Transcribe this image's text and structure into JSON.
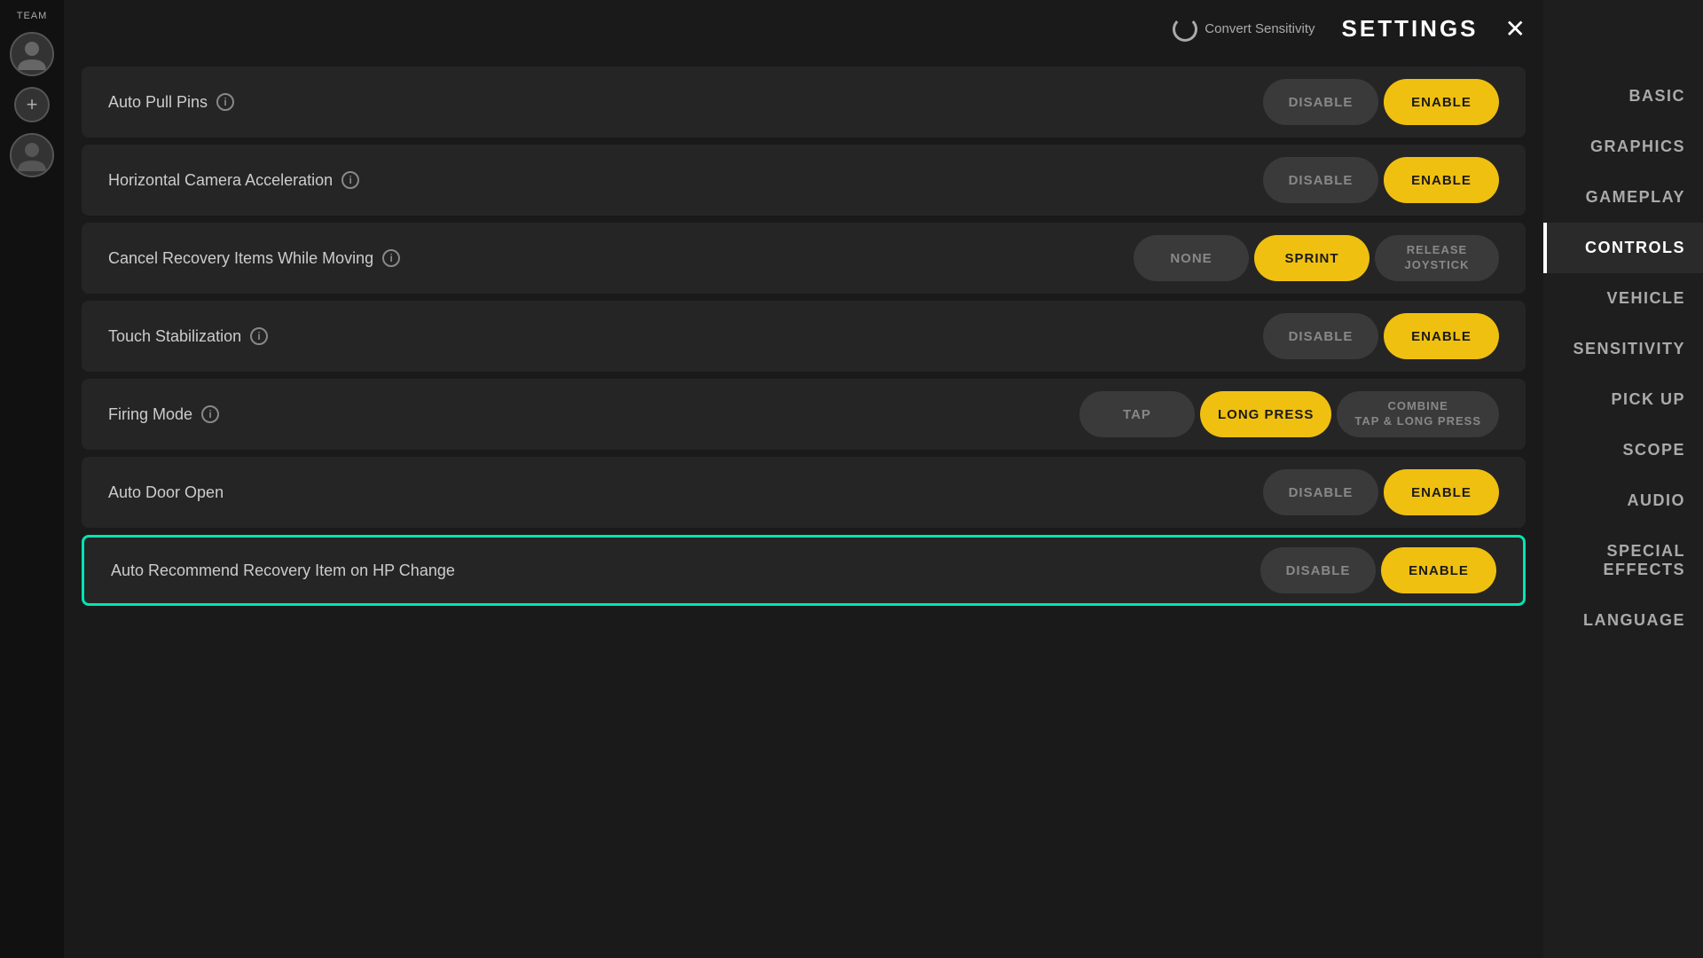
{
  "header": {
    "convert_sensitivity_label": "Convert Sensitivity",
    "settings_title": "SETTINGS",
    "close_label": "✕"
  },
  "left_sidebar": {
    "team_label": "TEAM"
  },
  "right_nav": {
    "items": [
      {
        "id": "basic",
        "label": "BASIC",
        "active": false
      },
      {
        "id": "graphics",
        "label": "GRAPHICS",
        "active": false
      },
      {
        "id": "gameplay",
        "label": "GAMEPLAY",
        "active": false
      },
      {
        "id": "controls",
        "label": "CONTROLS",
        "active": true
      },
      {
        "id": "vehicle",
        "label": "VEHICLE",
        "active": false
      },
      {
        "id": "sensitivity",
        "label": "SENSITIVITY",
        "active": false
      },
      {
        "id": "pickup",
        "label": "PICK UP",
        "active": false
      },
      {
        "id": "scope",
        "label": "SCOPE",
        "active": false
      },
      {
        "id": "audio",
        "label": "AUDIO",
        "active": false
      },
      {
        "id": "special_effects",
        "label": "SPECIAL EFFECTS",
        "active": false
      },
      {
        "id": "language",
        "label": "LANGUAGE",
        "active": false
      }
    ]
  },
  "settings_rows": [
    {
      "id": "auto_pull_pins",
      "label": "Auto Pull Pins",
      "has_info": true,
      "highlighted": false,
      "controls": [
        {
          "id": "disable",
          "label": "DISABLE",
          "active": false
        },
        {
          "id": "enable",
          "label": "ENABLE",
          "active": true
        }
      ]
    },
    {
      "id": "horizontal_camera_acceleration",
      "label": "Horizontal Camera Acceleration",
      "has_info": true,
      "highlighted": false,
      "controls": [
        {
          "id": "disable",
          "label": "DISABLE",
          "active": false
        },
        {
          "id": "enable",
          "label": "ENABLE",
          "active": true
        }
      ]
    },
    {
      "id": "cancel_recovery_items",
      "label": "Cancel Recovery Items While Moving",
      "has_info": true,
      "highlighted": false,
      "controls": [
        {
          "id": "none",
          "label": "NONE",
          "active": false
        },
        {
          "id": "sprint",
          "label": "SPRINT",
          "active": true
        },
        {
          "id": "release_joystick",
          "label": "RELEASE\nJOYSTICK",
          "active": false,
          "small": true
        }
      ]
    },
    {
      "id": "touch_stabilization",
      "label": "Touch Stabilization",
      "has_info": true,
      "highlighted": false,
      "controls": [
        {
          "id": "disable",
          "label": "DISABLE",
          "active": false
        },
        {
          "id": "enable",
          "label": "ENABLE",
          "active": true
        }
      ]
    },
    {
      "id": "firing_mode",
      "label": "Firing Mode",
      "has_info": true,
      "highlighted": false,
      "controls": [
        {
          "id": "tap",
          "label": "TAP",
          "active": false
        },
        {
          "id": "long_press",
          "label": "LONG PRESS",
          "active": true
        },
        {
          "id": "combine",
          "label": "COMBINE\nTAP & LONG PRESS",
          "active": false,
          "small": true
        }
      ]
    },
    {
      "id": "auto_door_open",
      "label": "Auto Door Open",
      "has_info": false,
      "highlighted": false,
      "controls": [
        {
          "id": "disable",
          "label": "DISABLE",
          "active": false
        },
        {
          "id": "enable",
          "label": "ENABLE",
          "active": true
        }
      ]
    },
    {
      "id": "auto_recommend_recovery",
      "label": "Auto Recommend Recovery Item on HP Change",
      "has_info": false,
      "highlighted": true,
      "controls": [
        {
          "id": "disable",
          "label": "DISABLE",
          "active": false
        },
        {
          "id": "enable",
          "label": "ENABLE",
          "active": true
        }
      ]
    }
  ],
  "colors": {
    "active_btn": "#f0c010",
    "inactive_btn": "#3a3a3a",
    "highlight_border": "#00e5b4"
  }
}
